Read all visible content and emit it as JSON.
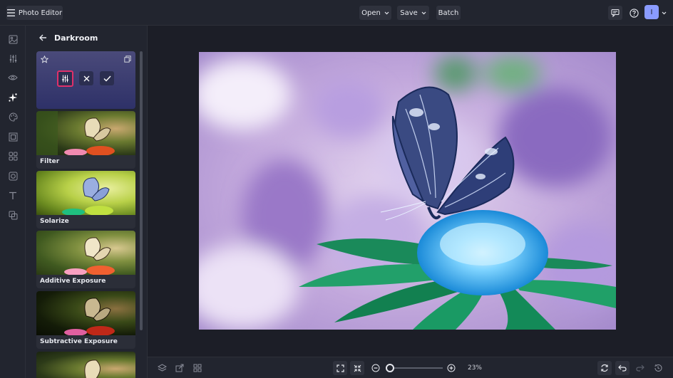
{
  "app": {
    "title": "Photo Editor"
  },
  "toolbar": {
    "open_label": "Open",
    "save_label": "Save",
    "batch_label": "Batch",
    "avatar_initial": "I"
  },
  "panel": {
    "title": "Darkroom",
    "items": [
      {
        "label": "Filter"
      },
      {
        "label": "Solarize"
      },
      {
        "label": "Additive Exposure"
      },
      {
        "label": "Subtractive Exposure"
      }
    ]
  },
  "status": {
    "zoom": "23%"
  },
  "colors": {
    "accent": "#8a9bff",
    "highlight": "#e0306a",
    "selected_top": "#4a4a7a",
    "selected_bottom": "#2e3168"
  }
}
